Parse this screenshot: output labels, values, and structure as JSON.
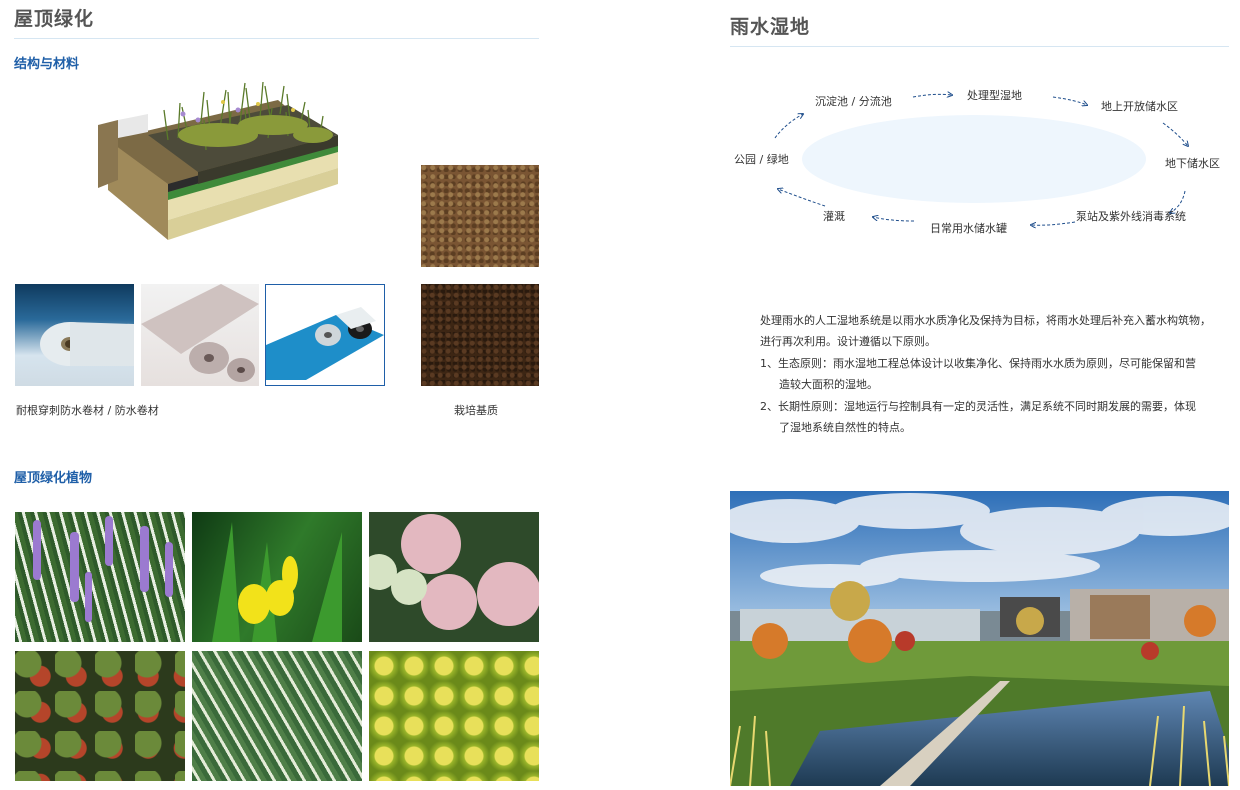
{
  "left": {
    "title": "屋顶绿化",
    "section1": "结构与材料",
    "caption_membrane": "耐根穿刺防水卷材 / 防水卷材",
    "caption_substrate": "栽培基质",
    "section2": "屋顶绿化植物"
  },
  "right": {
    "title": "雨水湿地",
    "cycle": {
      "n1": "沉淀池 / 分流池",
      "n2": "处理型湿地",
      "n3": "地上开放储水区",
      "n4": "地下储水区",
      "n5": "泵站及紫外线消毒系统",
      "n6": "日常用水储水罐",
      "n7": "灌溉",
      "n8": "公园 / 绿地"
    },
    "text": {
      "l1": "处理雨水的人工湿地系统是以雨水水质净化及保持为目标，将雨水处理后补充入蓄水构筑物，",
      "l2": "进行再次利用。设计遵循以下原则。",
      "l3": "1、生态原则：雨水湿地工程总体设计以收集净化、保持雨水水质为原则，尽可能保留和营",
      "l4": "造较大面积的湿地。",
      "l5": "2、长期性原则：湿地运行与控制具有一定的灵活性，满足系统不同时期发展的需要，体现",
      "l6": "了湿地系统自然性的特点。"
    }
  },
  "colors": {
    "heading_blue": "#1f5fa8",
    "rule": "#d6e6f2",
    "arrow": "#1f4e8c",
    "ellipse": "#eef6fd"
  }
}
